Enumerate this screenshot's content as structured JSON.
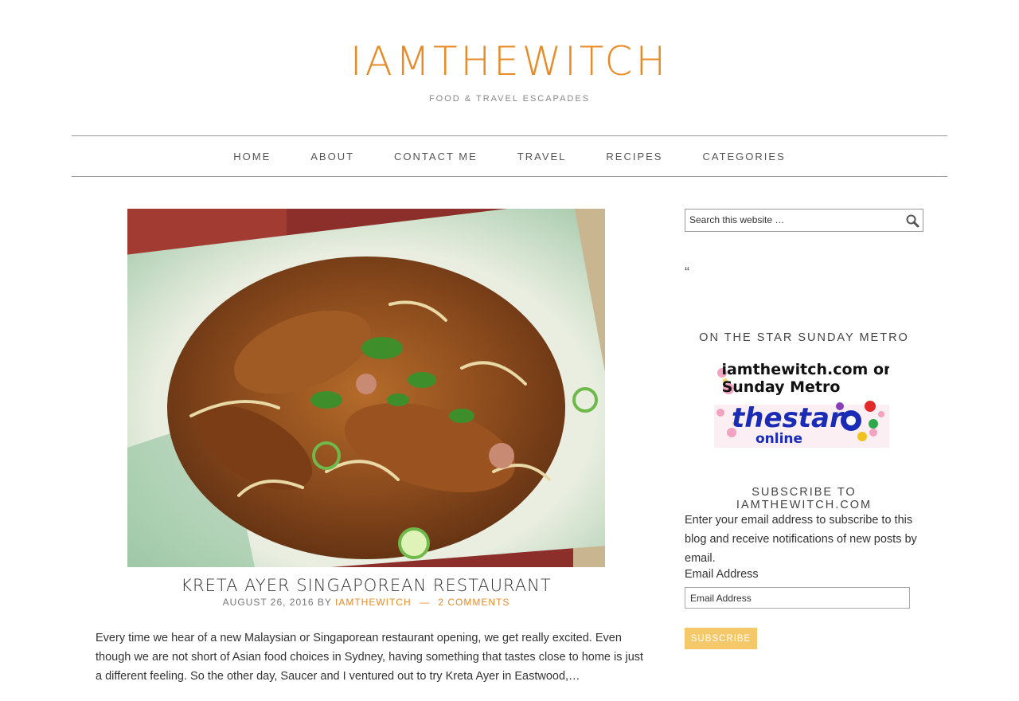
{
  "site": {
    "title": "IAMTHEWITCH",
    "tagline": "FOOD & TRAVEL ESCAPADES"
  },
  "nav": {
    "items": [
      {
        "label": "HOME"
      },
      {
        "label": "ABOUT"
      },
      {
        "label": "CONTACT ME"
      },
      {
        "label": "TRAVEL"
      },
      {
        "label": "RECIPES"
      },
      {
        "label": "CATEGORIES"
      }
    ]
  },
  "post": {
    "title": "KRETA AYER SINGAPOREAN RESTAURANT",
    "date": "AUGUST 26, 2016",
    "by": "BY",
    "author": "IAMTHEWITCH",
    "separator": "—",
    "comments": "2 COMMENTS",
    "excerpt": "Every time we hear of a new Malaysian or Singaporean restaurant opening, we get really excited. Even though we are not short of Asian food choices in Sydney, having something that tastes close to home is just a different feeling. So the other day, Saucer and I ventured out to try Kreta Ayer in Eastwood,…"
  },
  "sidebar": {
    "search": {
      "placeholder": "Search this website …"
    },
    "quote_mark": "“",
    "star_widget": {
      "title": "ON THE STAR SUNDAY METRO",
      "badge_line1": "iamthewitch.com on",
      "badge_line2": "Sunday Metro",
      "badge_brand": "thestar",
      "badge_sub": "online"
    },
    "subscribe": {
      "title": "SUBSCRIBE TO IAMTHEWITCH.COM",
      "text": "Enter your email address to subscribe to this blog and receive notifications of new posts by email.",
      "email_label": "Email Address",
      "email_placeholder": "Email Address",
      "button": "SUBSCRIBE"
    }
  },
  "colors": {
    "accent": "#e88a26",
    "button": "#f5c86a"
  }
}
